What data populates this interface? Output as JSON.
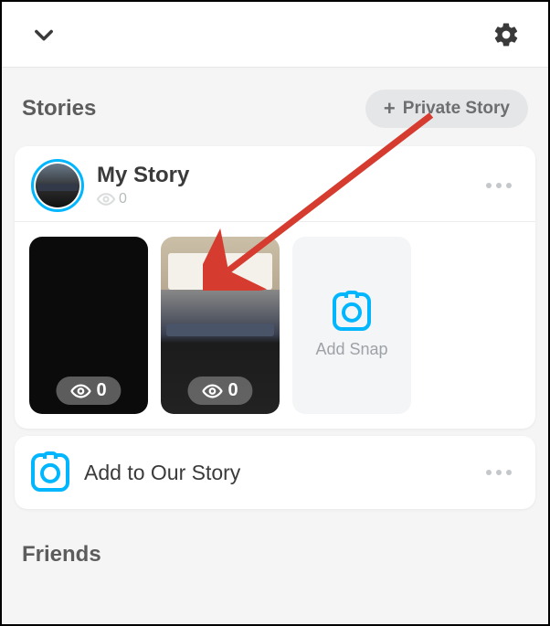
{
  "topbar": {
    "back_icon": "chevron-down",
    "settings_icon": "gear"
  },
  "stories": {
    "title": "Stories",
    "private_button_label": "Private Story",
    "my_story": {
      "title": "My Story",
      "views": "0",
      "snaps": [
        {
          "views": "0",
          "kind": "dark"
        },
        {
          "views": "0",
          "kind": "photo"
        }
      ],
      "add_snap_label": "Add Snap"
    },
    "our_story": {
      "label": "Add to Our Story"
    }
  },
  "friends": {
    "title": "Friends"
  },
  "colors": {
    "accent": "#00b7ff"
  }
}
